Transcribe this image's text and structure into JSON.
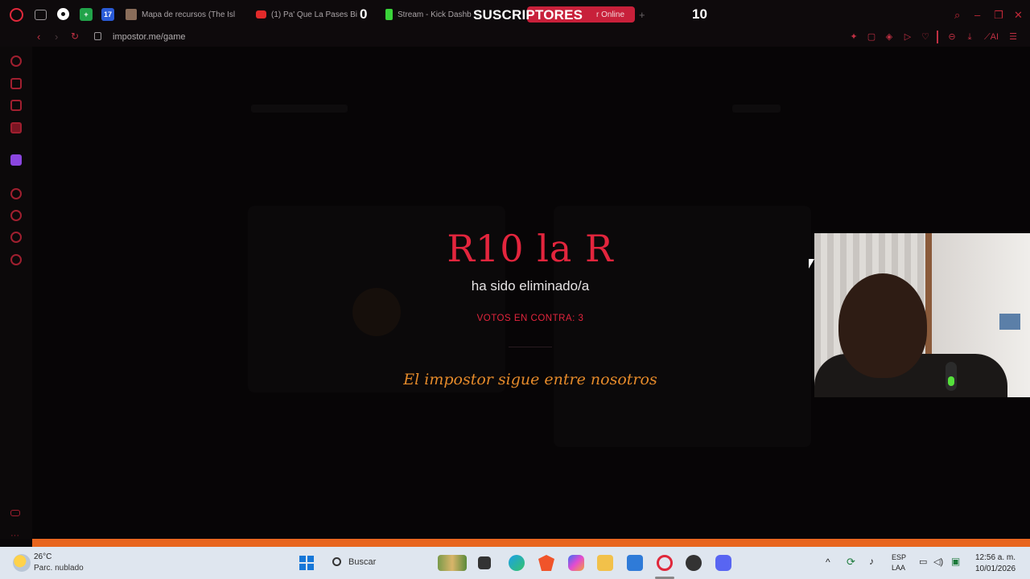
{
  "browser": {
    "tabs": [
      {
        "label": "Mapa de recursos (The Isl",
        "icon": "game-favicon-icon",
        "color": "#8a6d5a"
      },
      {
        "label": "(1) Pa' Que La Pases Bi",
        "icon": "youtube-icon",
        "color": "#e12a2a"
      },
      {
        "label": "Stream - Kick Dashb",
        "icon": "kick-icon",
        "color": "#3ad33a"
      },
      {
        "label": "r Online",
        "icon": "impostor-icon",
        "color": "#c8203a"
      }
    ],
    "new_tab_label": "+",
    "url": "impostor.me/game"
  },
  "overlay": {
    "count_left": "0",
    "label": "SUSCRIPTORES",
    "count_right": "10"
  },
  "game": {
    "player_name": "R10 la R",
    "status_text": "ha sido eliminado/a",
    "votes_text": "VOTOS EN CONTRA: 3",
    "result_message": "El impostor sigue entre nosotros"
  },
  "colors": {
    "accent_red": "#e3253d",
    "accent_orange": "#e58a2a",
    "background": "#070506"
  },
  "taskbar": {
    "weather_temp": "26°C",
    "weather_desc": "Parc. nublado",
    "search_label": "Buscar",
    "lang_line1": "ESP",
    "lang_line2": "LAA",
    "time": "12:56 a. m.",
    "date": "10/01/2026"
  }
}
